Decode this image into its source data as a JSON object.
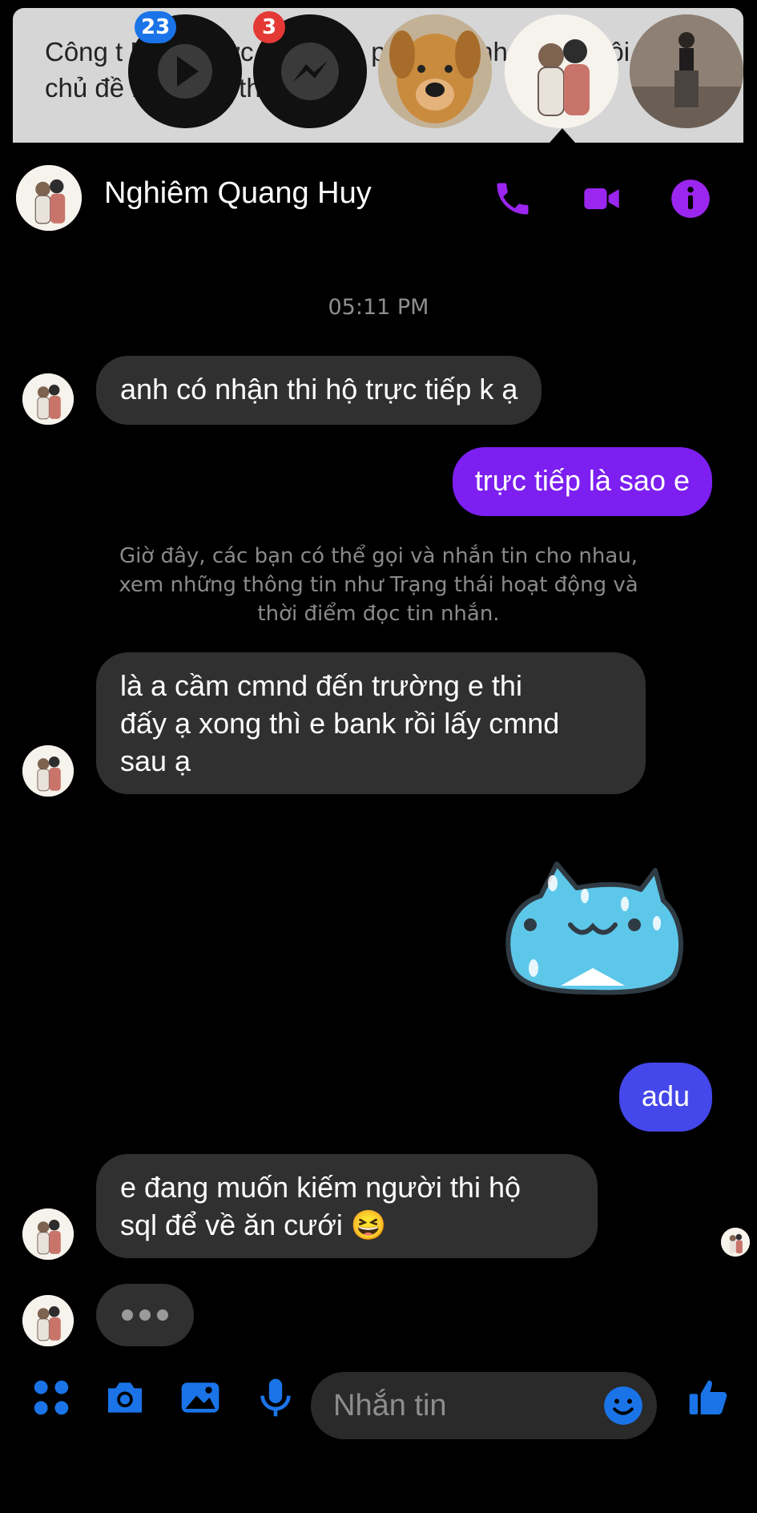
{
  "background_article": {
    "text": "Công t NI một tức vi liệt kê, p t c t tin nhanh về nội dung chủ đề bạn viết, thông tin"
  },
  "chat_heads": [
    {
      "name": "video-app-head",
      "badge": "23"
    },
    {
      "name": "messenger-head",
      "badge": "3"
    },
    {
      "name": "dog-head"
    },
    {
      "name": "couple-head",
      "selected": true
    },
    {
      "name": "person-head"
    }
  ],
  "header": {
    "contact_name": "Nghiêm Quang Huy",
    "accent_color": "#9b26f0"
  },
  "conversation": {
    "timestamp": "05:11 PM",
    "messages": [
      {
        "sender": "contact",
        "text": "anh có nhận thi hộ trực tiếp k ạ"
      },
      {
        "sender": "me",
        "text": "trực tiếp là sao e"
      },
      {
        "sender": "system",
        "text": "Giờ đây, các bạn có thể gọi và nhắn tin cho nhau,\nxem những thông tin như Trạng thái hoạt động và\nthời điểm đọc tin nhắn."
      },
      {
        "sender": "contact",
        "text": "là a cầm cmnd đến trường e thi\nđấy ạ xong thì e bank rồi lấy cmnd\nsau ạ"
      },
      {
        "sender": "me",
        "type": "sticker",
        "sticker": "blue-cat-sticker"
      },
      {
        "sender": "me",
        "text": "adu"
      },
      {
        "sender": "contact",
        "text": "e đang muốn kiếm người thi hộ\nsql để về ăn cưới 😆"
      },
      {
        "sender": "contact",
        "type": "typing"
      }
    ]
  },
  "composer": {
    "placeholder": "Nhắn tin",
    "icons": [
      "apps-icon",
      "camera-icon",
      "image-icon",
      "mic-icon",
      "emoji-icon",
      "thumbs-up-icon"
    ],
    "icon_color": "#1a74e8"
  },
  "colors": {
    "incoming_bubble": "#303030",
    "outgoing_purple": "#7c1ff0",
    "outgoing_blue": "#4447ea",
    "badge_blue": "#1a74e8",
    "badge_red": "#e53935"
  }
}
